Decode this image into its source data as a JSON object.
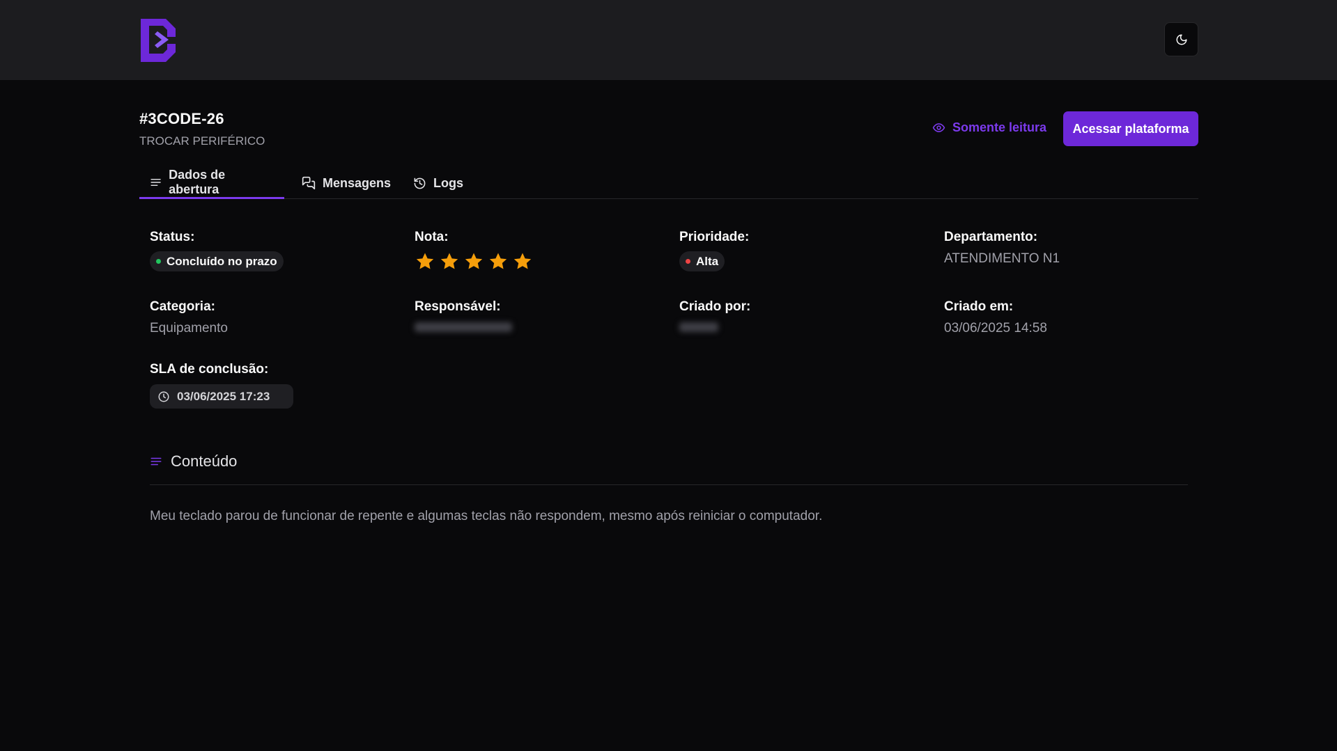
{
  "colors": {
    "accent": "#7c3aed",
    "button": "#6d28d9",
    "status_dot": "#22c55e",
    "priority_dot": "#ef4444",
    "star": "#f59e0b"
  },
  "header": {
    "logo_icon": "brand-logo",
    "theme_toggle_icon": "moon-icon"
  },
  "ticket": {
    "id": "#3CODE-26",
    "subject": "TROCAR PERIFÉRICO"
  },
  "actions": {
    "readonly_icon": "eye-icon",
    "readonly_label": "Somente leitura",
    "access_label": "Acessar plataforma"
  },
  "tabs": [
    {
      "label": "Dados de abertura",
      "icon": "list-icon",
      "active": true
    },
    {
      "label": "Mensagens",
      "icon": "messages-icon",
      "active": false
    },
    {
      "label": "Logs",
      "icon": "history-icon",
      "active": false
    }
  ],
  "fields": {
    "status_label": "Status:",
    "status_value": "Concluído no prazo",
    "rating_label": "Nota:",
    "rating_value": 5,
    "rating_max": 5,
    "priority_label": "Prioridade:",
    "priority_value": "Alta",
    "department_label": "Departamento:",
    "department_value": "ATENDIMENTO N1",
    "category_label": "Categoria:",
    "category_value": "Equipamento",
    "responsible_label": "Responsável:",
    "created_by_label": "Criado por:",
    "created_at_label": "Criado em:",
    "created_at_value": "03/06/2025 14:58",
    "sla_label": "SLA de conclusão:",
    "sla_value": "03/06/2025 17:23"
  },
  "content": {
    "title": "Conteúdo",
    "text": "Meu teclado parou de funcionar de repente e algumas teclas não respondem, mesmo após reiniciar o computador."
  }
}
